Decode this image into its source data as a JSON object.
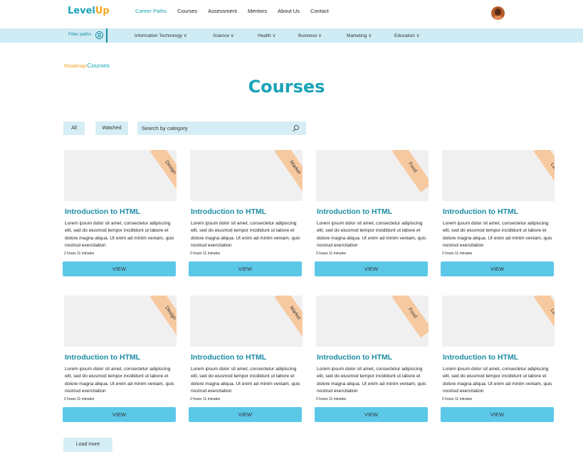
{
  "header": {
    "logo_part1": "Level",
    "logo_part2": "Up",
    "nav": [
      "Career Paths",
      "Courses",
      "Assessment",
      "Mentors",
      "About Us",
      "Contact"
    ],
    "active_nav": "Career Paths"
  },
  "category_bar": {
    "filter_label": "Filter paths",
    "categories": [
      "Information Technology ∨",
      "Science ∨",
      "Health ∨",
      "Business ∨",
      "Marketing ∨",
      "Education ∨"
    ]
  },
  "breadcrumb": {
    "root": "Roadmap",
    "separator": "/",
    "current": "Courses"
  },
  "page_title": "Courses",
  "filters": {
    "all_label": "All",
    "watched_label": "Watched",
    "search_placeholder": "Search by category"
  },
  "courses": [
    {
      "tag": "Design",
      "title": "Introduction to HTML",
      "description": "Lorem ipsum dolor sit amet, consectetur adipiscing elit, sed do eiusmod tempor incididunt ut labore et dolore magna aliqua. Ut enim ad minim veniam, quis nostrud exercitation",
      "duration": "2 hours 11 minutes",
      "button": "VIEW"
    },
    {
      "tag": "Market",
      "title": "Introduction to HTML",
      "description": "Lorem ipsum dolor sit amet, consectetur adipiscing elit, sed do eiusmod tempor incididunt ut labore et dolore magna aliqua. Ut enim ad minim veniam, quis nostrud exercitation",
      "duration": "2 hours 11 minutes",
      "button": "VIEW"
    },
    {
      "tag": "Food",
      "title": "Introduction to HTML",
      "description": "Lorem ipsum dolor sit amet, consectetur adipiscing elit, sed do eiusmod tempor incididunt ut labore et dolore magna aliqua. Ut enim ad minim veniam, quis nostrud exercitation",
      "duration": "2 hours 11 minutes",
      "button": "VIEW"
    },
    {
      "tag": "Law",
      "title": "Introduction to HTML",
      "description": "Lorem ipsum dolor sit amet, consectetur adipiscing elit, sed do eiusmod tempor incididunt ut labore et dolore magna aliqua. Ut enim ad minim veniam, quis nostrud exercitation",
      "duration": "2 hours 11 minutes",
      "button": "VIEW"
    },
    {
      "tag": "Design",
      "title": "Introduction to HTML",
      "description": "Lorem ipsum dolor sit amet, consectetur adipiscing elit, sed do eiusmod tempor incididunt ut labore et dolore magna aliqua. Ut enim ad minim veniam, quis nostrud exercitation",
      "duration": "2 hours 11 minutes",
      "button": "VIEW"
    },
    {
      "tag": "Market",
      "title": "Introduction to HTML",
      "description": "Lorem ipsum dolor sit amet, consectetur adipiscing elit, sed do eiusmod tempor incididunt ut labore et dolore magna aliqua. Ut enim ad minim veniam, quis nostrud exercitation",
      "duration": "2 hours 11 minutes",
      "button": "VIEW"
    },
    {
      "tag": "Food",
      "title": "Introduction to HTML",
      "description": "Lorem ipsum dolor sit amet, consectetur adipiscing elit, sed do eiusmod tempor incididunt ut labore et dolore magna aliqua. Ut enim ad minim veniam, quis nostrud exercitation",
      "duration": "2 hours 11 minutes",
      "button": "VIEW"
    },
    {
      "tag": "Law",
      "title": "Introduction to HTML",
      "description": "Lorem ipsum dolor sit amet, consectetur adipiscing elit, sed do eiusmod tempor incididunt ut labore et dolore magna aliqua. Ut enim ad minim veniam, quis nostrud exercitation",
      "duration": "2 hours 11 minutes",
      "button": "VIEW"
    }
  ],
  "load_more": "Load more",
  "colors": {
    "primary": "#1aa3b8",
    "accent": "#f5a623",
    "button": "#5bc8e8",
    "light": "#d5eef6",
    "ribbon": "#f7c9a0"
  }
}
